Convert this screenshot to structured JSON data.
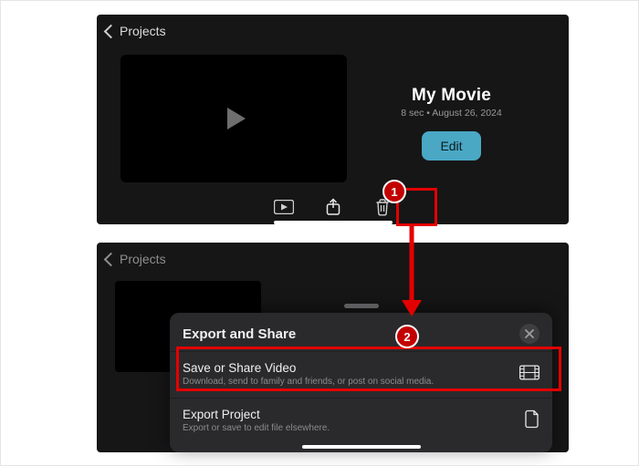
{
  "back_label": "Projects",
  "project": {
    "title": "My Movie",
    "meta": "8 sec • August 26, 2024",
    "edit_btn": "Edit"
  },
  "sheet": {
    "title": "Export and Share",
    "row1": {
      "title": "Save or Share Video",
      "sub": "Download, send to family and friends, or post on social media."
    },
    "row2": {
      "title": "Export Project",
      "sub": "Export or save to edit file elsewhere."
    }
  },
  "annot": {
    "b1": "1",
    "b2": "2"
  }
}
